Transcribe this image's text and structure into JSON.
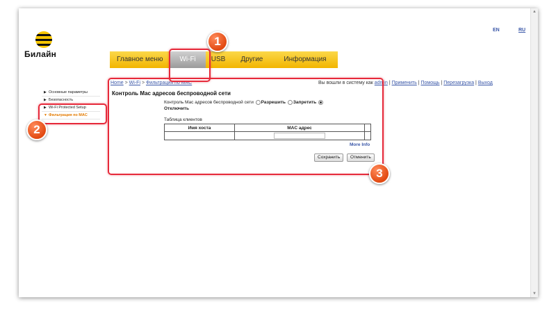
{
  "brand": {
    "logo_text": "Билайн",
    "accent": "#f7c600"
  },
  "lang": {
    "en": "EN",
    "ru": "RU"
  },
  "nav": {
    "items": [
      "Главное меню",
      "Wi-Fi",
      "USB",
      "Другие",
      "Информация"
    ],
    "active": "Wi-Fi"
  },
  "sidebar": {
    "items": [
      "Основные параметры",
      "Безопасность",
      "Wi-Fi Protected Setup",
      "Фильтрация по MAC"
    ],
    "active": "Фильтрация по MAC"
  },
  "breadcrumb": {
    "home": "Home",
    "sep1": " > ",
    "wifi": "Wi-Fi",
    "sep2": " > ",
    "current": "Фильтрация по MAC"
  },
  "topbar": {
    "logged_in": "Вы вошли в систему как",
    "user": "admin",
    "apply": "Применить",
    "help": "Помощь",
    "reboot": "Перезагрузка",
    "logout": "Выход",
    "sep": " | "
  },
  "panel": {
    "title": "Контроль Мас адресов беспроводной сети",
    "control_label": "Контроль Мас адресов беспроводной сети",
    "opt_allow": "Разрешить",
    "opt_deny": "Запретить",
    "opt_off": "Отключить",
    "table_label": "Таблица клиентов",
    "col_host": "Имя хоста",
    "col_mac": "MAC адрес",
    "more_info": "More Info",
    "save": "Сохранить",
    "cancel": "Отменить"
  },
  "annotations": {
    "one": "1",
    "two": "2",
    "three": "3",
    "color": "#e6293a"
  }
}
